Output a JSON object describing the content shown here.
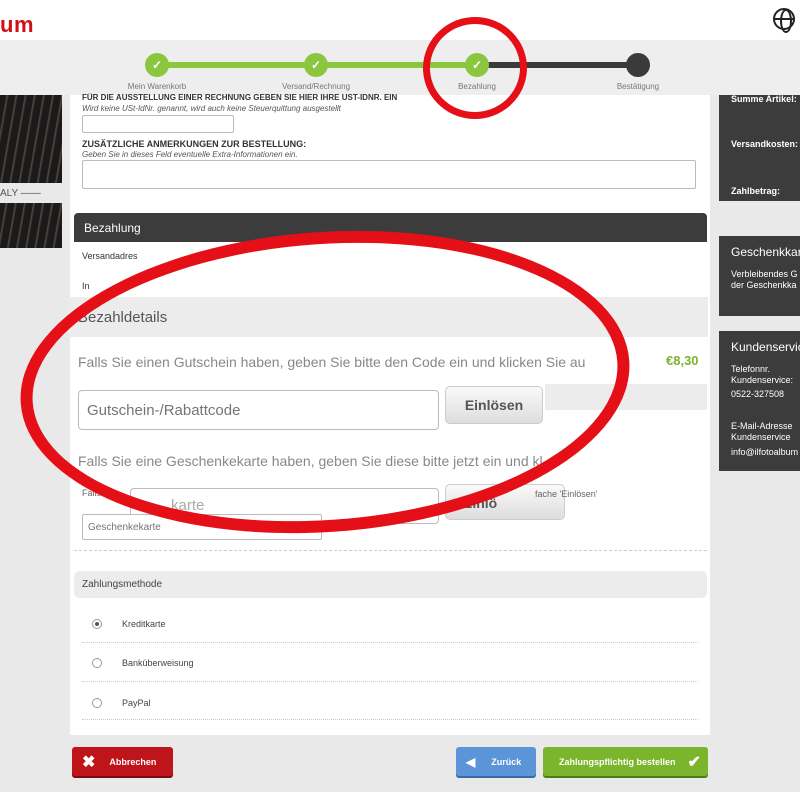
{
  "brand": {
    "logo_text": "um",
    "color": "#d01018"
  },
  "progress": {
    "steps": [
      {
        "label": "Mein Warenkorb",
        "state": "done"
      },
      {
        "label": "Versand/Rechnung",
        "state": "done"
      },
      {
        "label": "Bezahlung",
        "state": "done"
      },
      {
        "label": "Bestätigung",
        "state": "todo"
      }
    ],
    "check": "✓"
  },
  "left_banner": {
    "text": "ALY ——"
  },
  "invoice": {
    "vat_heading": "FÜR DIE AUSSTELLUNG EINER RECHNUNG GEBEN SIE HIER IHRE UST-IDNR. EIN",
    "vat_note": "Wird keine USt-IdNr. genannt, wird auch keine Steuerquittung ausgestellt",
    "remarks_heading": "ZUSÄTZLICHE ANMERKUNGEN ZUR BESTELLUNG:",
    "remarks_note": "Geben Sie in dieses Feld eventuelle Extra-Informationen ein."
  },
  "payment": {
    "header": "Bezahlung",
    "shipping_address_label": "Versandadres",
    "row2_label": "In"
  },
  "zoom": {
    "title": "Bezahldetails",
    "coupon_text": "Falls Sie einen Gutschein haben, geben Sie bitte den Code ein und klicken Sie au",
    "coupon_placeholder": "Gutschein-/Rabattcode",
    "redeem_label": "Einlösen",
    "price": "€8,30",
    "giftcard_text": "Falls Sie eine Geschenkekarte haben, geben Sie diese bitte jetzt ein und kl",
    "giftcard_ghost": "karte",
    "redeem_label_partial": "Einlö"
  },
  "giftcard_small": {
    "label_left": "Falls S",
    "label_right": "fache 'Einlösen'",
    "placeholder": "Geschenkekarte"
  },
  "payment_method": {
    "header": "Zahlungsmethode",
    "options": [
      {
        "label": "Kreditkarte",
        "selected": true
      },
      {
        "label": "Banküberweisung",
        "selected": false
      },
      {
        "label": "PayPal",
        "selected": false
      }
    ]
  },
  "buttons": {
    "cancel": "Abbrechen",
    "back": "Zurück",
    "submit": "Zahlungspflichtig bestellen"
  },
  "sidebar": {
    "summary": {
      "items_label": "Summe Artikel:",
      "shipping_label": "Versandkosten:",
      "total_label": "Zahlbetrag:"
    },
    "giftcard": {
      "title": "Geschenkkarte",
      "line1": "Verbleibendes G",
      "line2": "der Geschenkka"
    },
    "service": {
      "title": "Kundenservice",
      "phone_label_1": "Telefonnr.",
      "phone_label_2": "Kundenservice:",
      "phone": "0522-327508",
      "email_label_1": "E-Mail-Adresse",
      "email_label_2": "Kundenservice",
      "email": "info@ilfotoalbum"
    }
  },
  "colors": {
    "accent_green": "#8cc63f",
    "danger_red": "#c0141b",
    "back_blue": "#5b94d8",
    "annotation_red": "#e50f17"
  }
}
